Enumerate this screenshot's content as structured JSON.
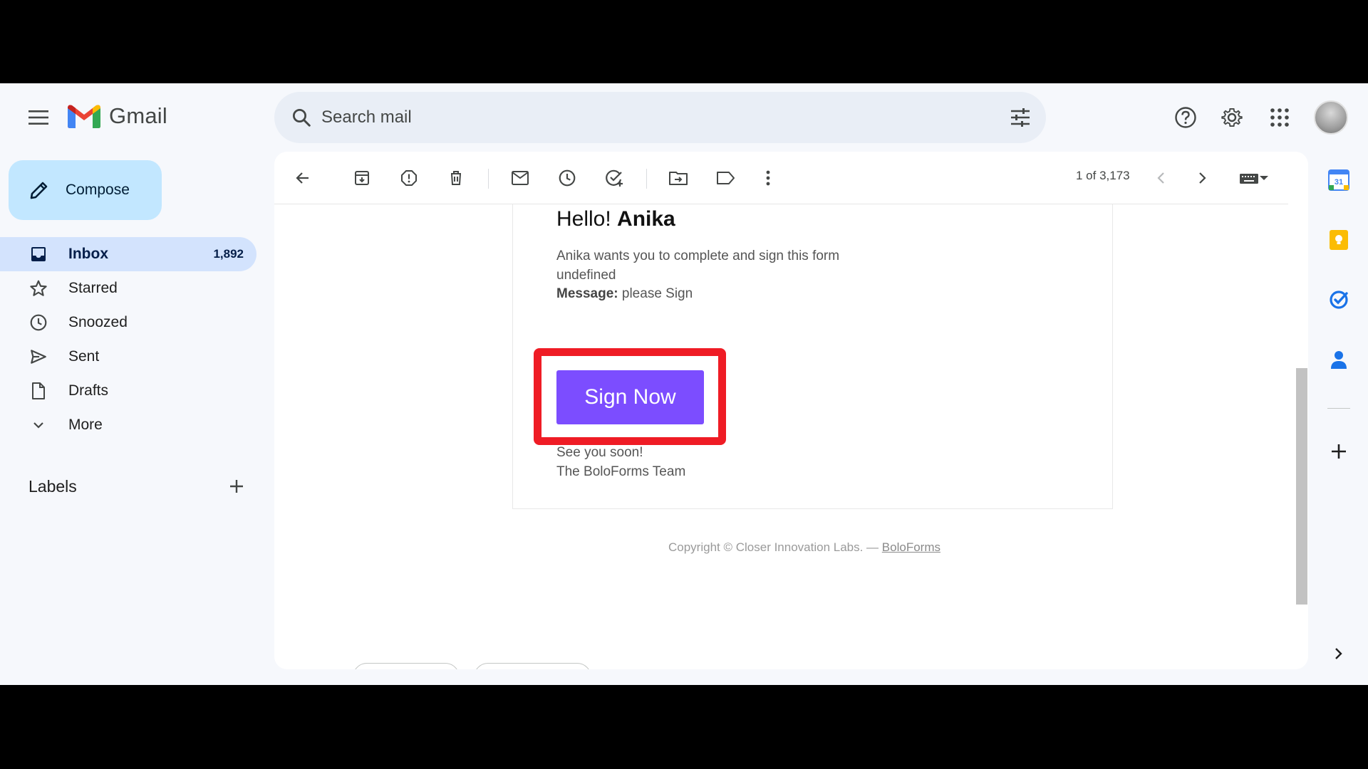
{
  "header": {
    "app_name": "Gmail",
    "search_placeholder": "Search mail"
  },
  "sidebar": {
    "compose_label": "Compose",
    "items": [
      {
        "label": "Inbox",
        "count": "1,892",
        "icon": "inbox-icon",
        "active": true
      },
      {
        "label": "Starred",
        "icon": "star-icon"
      },
      {
        "label": "Snoozed",
        "icon": "clock-icon"
      },
      {
        "label": "Sent",
        "icon": "send-icon"
      },
      {
        "label": "Drafts",
        "icon": "draft-icon"
      },
      {
        "label": "More",
        "icon": "chevron-down-icon"
      }
    ],
    "labels_title": "Labels"
  },
  "toolbar": {
    "pager_text": "1 of 3,173"
  },
  "email": {
    "greeting": "Hello!",
    "recipient_name": "Anika",
    "intro": "Anika wants you to complete and sign this form undefined",
    "message_label": "Message:",
    "message_text": "please Sign",
    "button_label": "Sign Now",
    "closing_line1": "See you soon!",
    "closing_line2": "The BoloForms Team",
    "copyright": "Copyright © Closer Innovation Labs. —",
    "copyright_link": "BoloForms"
  },
  "colors": {
    "button": "#7c4dff",
    "highlight": "#ef1c25",
    "active_nav": "#d3e3fd",
    "compose": "#c2e7ff"
  }
}
